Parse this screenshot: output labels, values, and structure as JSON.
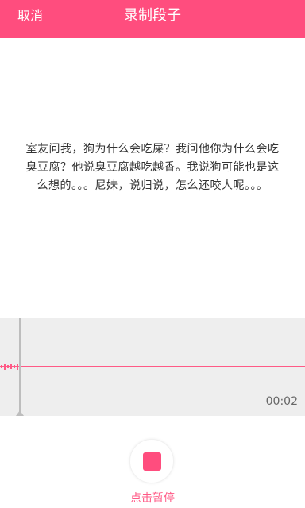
{
  "header": {
    "cancel_label": "取消",
    "title": "录制段子"
  },
  "joke": {
    "text": "室友问我，狗为什么会吃屎？我问他你为什么会吃臭豆腐？他说臭豆腐越吃越香。我说狗可能也是这么想的。。。尼妹，说归说，怎么还咬人呢。。。"
  },
  "recorder": {
    "elapsed": "00:02",
    "action_label": "点击暂停"
  },
  "colors": {
    "accent": "#ff4d7e",
    "waveform": "#ff5a86",
    "panel_bg": "#eeeeee"
  },
  "icons": {
    "stop": "stop-icon"
  }
}
